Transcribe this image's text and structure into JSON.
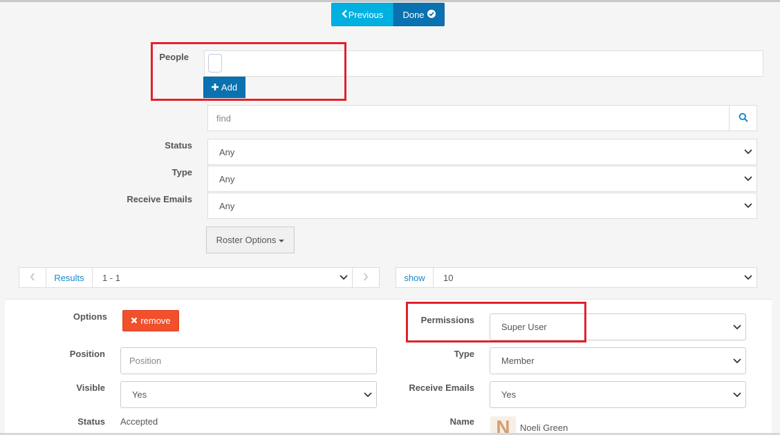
{
  "nav": {
    "previous_label": "Previous",
    "done_label": "Done"
  },
  "people": {
    "label": "People",
    "add_label": "Add"
  },
  "search": {
    "placeholder": "find"
  },
  "filters": {
    "status": {
      "label": "Status",
      "value": "Any"
    },
    "type": {
      "label": "Type",
      "value": "Any"
    },
    "receive_emails": {
      "label": "Receive Emails",
      "value": "Any"
    }
  },
  "roster_options_label": "Roster Options",
  "pager": {
    "results_label": "Results",
    "range": "1 - 1",
    "show_label": "show",
    "page_size": "10"
  },
  "member": {
    "options_label": "Options",
    "remove_label": "remove",
    "permissions": {
      "label": "Permissions",
      "value": "Super User"
    },
    "position": {
      "label": "Position",
      "placeholder": "Position"
    },
    "type": {
      "label": "Type",
      "value": "Member"
    },
    "visible": {
      "label": "Visible",
      "value": "Yes"
    },
    "receive_emails": {
      "label": "Receive Emails",
      "value": "Yes"
    },
    "status": {
      "label": "Status",
      "value": "Accepted"
    },
    "name": {
      "label": "Name",
      "value": "Noeli Green",
      "avatar_letter": "N"
    }
  },
  "colors": {
    "highlight": "#e0212c",
    "primary": "#0a72b0",
    "info": "#00b0e0",
    "danger": "#f0502c"
  }
}
